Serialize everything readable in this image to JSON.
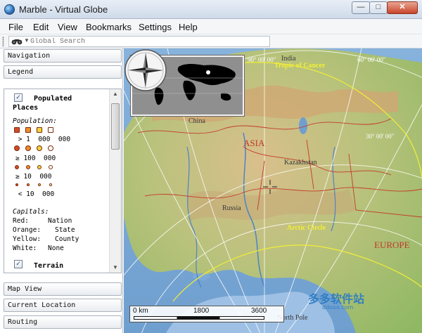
{
  "window": {
    "title": "Marble - Virtual Globe",
    "controls": {
      "minimize": "—",
      "maximize": "□",
      "close": "✕"
    }
  },
  "menu": [
    "File",
    "Edit",
    "View",
    "Bookmarks",
    "Settings",
    "Help"
  ],
  "search": {
    "placeholder": "Global Search",
    "icon": "binoculars-icon"
  },
  "panels": {
    "navigation": "Navigation",
    "legend": "Legend",
    "map_view": "Map View",
    "current_location": "Current Location",
    "routing": "Routing"
  },
  "legend": {
    "populated_places": {
      "checked": true,
      "title_line1": "Populated",
      "title_line2": "Places"
    },
    "population_label": "Population:",
    "population_rows": [
      " > 1  000  000",
      "≥ 100  000",
      "≥ 10  000",
      " < 10  000"
    ],
    "capitals_label": "Capitals:",
    "capitals": [
      {
        "color": "Red:",
        "meaning": "Nation"
      },
      {
        "color": "Orange:",
        "meaning": "State"
      },
      {
        "color": "Yellow:",
        "meaning": "County"
      },
      {
        "color": "White:",
        "meaning": "None"
      }
    ],
    "terrain": {
      "checked": true,
      "title": "Terrain"
    }
  },
  "map": {
    "labels": {
      "india": "India",
      "tropic_of_cancer": "Tropic of Cancer",
      "graticule_90": "90° 00' 00\"",
      "graticule_60": "60° 00' 00\"",
      "graticule_30": "30° 00' 00\"",
      "china": "China",
      "asia": "ASIA",
      "kazakhstan": "Kazakhstan",
      "russia": "Russia",
      "arctic_circle": "Arctic Circle",
      "europe": "EUROPE",
      "north_pole": "North Pole"
    },
    "scale": {
      "start": "0 km",
      "mid": "1800",
      "end": "3600"
    },
    "watermark": {
      "text": "多多软件站",
      "sub": "ddooo.com"
    }
  },
  "colors": {
    "ocean": "#7aa7d4",
    "land_low": "#9cbf6a",
    "land_high": "#d7b98a",
    "border": "#c43a2a",
    "graticule": "#ffffff",
    "tropic": "#f2ef35"
  }
}
